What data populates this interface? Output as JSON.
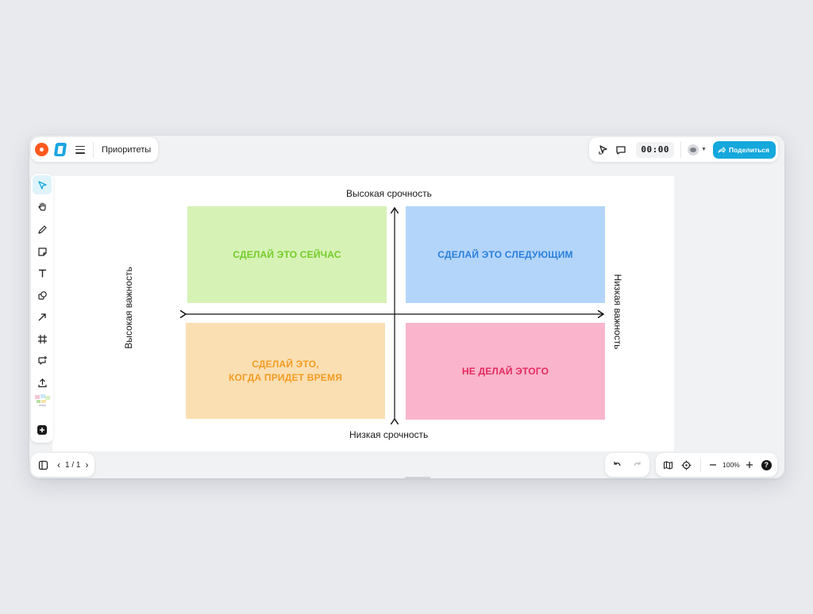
{
  "header": {
    "board_title": "Приоритеты",
    "timer": "00:00",
    "share_label": "Поделиться"
  },
  "matrix": {
    "axis_top": "Высокая срочность",
    "axis_bottom": "Низкая срочность",
    "axis_left": "Высокая важность",
    "axis_right": "Низкая важность",
    "quadrants": [
      {
        "text": "СДЕЛАЙ ЭТО СЕЙЧАС",
        "bg": "#d6f2b5",
        "color": "#73cc27"
      },
      {
        "text": "СДЕЛАЙ ЭТО СЛЕДУЮЩИМ",
        "bg": "#b4d5fa",
        "color": "#2a80dc"
      },
      {
        "text": "СДЕЛАЙ ЭТО,\nКОГДА ПРИДЕТ ВРЕМЯ",
        "bg": "#fadfb3",
        "color": "#f39c23"
      },
      {
        "text": "НЕ ДЕЛАЙ ЭТОГО",
        "bg": "#fab5cc",
        "color": "#e42a61"
      }
    ]
  },
  "footer": {
    "page_indicator": "1 / 1",
    "zoom": "100%",
    "help_label": "?"
  },
  "colors": {
    "accent": "#14a8dc",
    "brand_orange": "#ff5a1f"
  },
  "toolbar": {
    "tools": [
      "select-tool",
      "hand-tool",
      "pen-tool",
      "sticky-note-tool",
      "text-tool",
      "shapes-tool",
      "arrow-tool",
      "frame-tool",
      "comment-add-tool",
      "upload-tool",
      "stickers",
      "more-tools"
    ]
  }
}
